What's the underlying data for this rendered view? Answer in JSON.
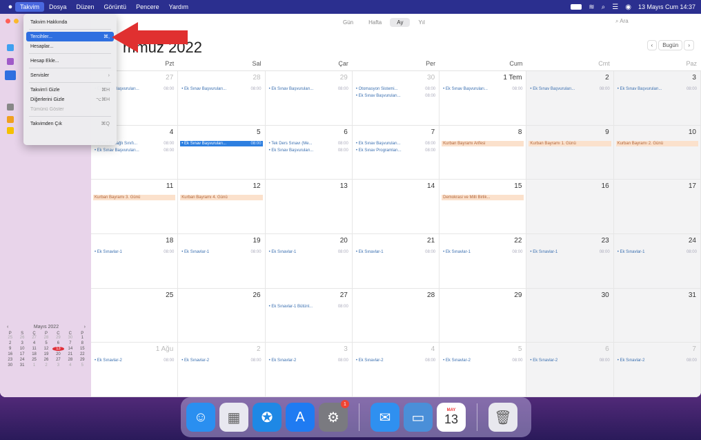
{
  "menubar": {
    "apple": "",
    "items": [
      "Takvim",
      "Dosya",
      "Düzen",
      "Görüntü",
      "Pencere",
      "Yardım"
    ],
    "active_index": 0,
    "datetime": "13 Mayıs Cum 14:37"
  },
  "app_menu": {
    "items": [
      {
        "label": "Takvim Hakkında",
        "shortcut": "",
        "type": "item"
      },
      {
        "type": "sep"
      },
      {
        "label": "Tercihler...",
        "shortcut": "⌘,",
        "type": "item",
        "highlight": true
      },
      {
        "label": "Hesaplar...",
        "shortcut": "",
        "type": "item"
      },
      {
        "type": "sep"
      },
      {
        "label": "Hesap Ekle...",
        "shortcut": "",
        "type": "item"
      },
      {
        "type": "sep"
      },
      {
        "label": "Servisler",
        "shortcut": "›",
        "type": "item"
      },
      {
        "type": "sep"
      },
      {
        "label": "Takvim'i Gizle",
        "shortcut": "⌘H",
        "type": "item"
      },
      {
        "label": "Diğerlerini Gizle",
        "shortcut": "⌥⌘H",
        "type": "item"
      },
      {
        "label": "Tümünü Göster",
        "shortcut": "",
        "type": "item",
        "disabled": true
      },
      {
        "type": "sep"
      },
      {
        "label": "Takvimden Çık",
        "shortcut": "⌘Q",
        "type": "item"
      }
    ]
  },
  "toolbar": {
    "views": [
      "Gün",
      "Hafta",
      "Ay",
      "Yıl"
    ],
    "selected_view": "Ay",
    "search_placeholder": "Ara"
  },
  "header": {
    "month_title": "mmuz 2022",
    "nav_prev": "‹",
    "today": "Bugün",
    "nav_next": "›"
  },
  "weekdays": [
    "Pzt",
    "Sal",
    "Çar",
    "Per",
    "Cum",
    "Cmt",
    "Paz"
  ],
  "weeks": [
    [
      {
        "day": "27",
        "dim": true,
        "events": [
          {
            "title": "Ek Sınav Başvuruları...",
            "time": "08:00"
          }
        ]
      },
      {
        "day": "28",
        "dim": true,
        "events": [
          {
            "title": "Ek Sınav Başvuruları...",
            "time": "08:00"
          }
        ]
      },
      {
        "day": "29",
        "dim": true,
        "events": [
          {
            "title": "Ek Sınav Başvuruları...",
            "time": "08:00"
          }
        ]
      },
      {
        "day": "30",
        "dim": true,
        "events": [
          {
            "title": "Otomasyon Sistemi...",
            "time": "08:00"
          },
          {
            "title": "Ek Sınav Başvuruları...",
            "time": "08:00"
          }
        ]
      },
      {
        "day": "1 Tem",
        "events": [
          {
            "title": "Ek Sınav Başvuruları...",
            "time": "08:00"
          }
        ]
      },
      {
        "day": "2",
        "events": [
          {
            "title": "Ek Sınav Başvuruları...",
            "time": "08:00"
          }
        ]
      },
      {
        "day": "3",
        "events": [
          {
            "title": "Ek Sınav Başvuruları...",
            "time": "08:00"
          }
        ]
      }
    ],
    [
      {
        "day": "4",
        "events": [
          {
            "title": "YÖKSİS Bağlı Sınıfı...",
            "time": "08:00"
          },
          {
            "title": "Ek Sınav Başvuruları...",
            "time": "08:00"
          }
        ]
      },
      {
        "day": "5",
        "events": [
          {
            "title": "Ek Sınav Başvuruları...",
            "time": "08:00",
            "selected": true
          }
        ]
      },
      {
        "day": "6",
        "events": [
          {
            "title": "Tek Ders Sınavı (Me...",
            "time": "08:00"
          },
          {
            "title": "Ek Sınav Başvuruları...",
            "time": "08:00"
          }
        ]
      },
      {
        "day": "7",
        "events": [
          {
            "title": "Ek Sınav Başvuruları...",
            "time": "08:00"
          },
          {
            "title": "Ek Sınav Programları...",
            "time": "08:00"
          }
        ]
      },
      {
        "day": "8",
        "events": [
          {
            "title": "Kurban Bayramı Arifesi",
            "allday": true
          }
        ]
      },
      {
        "day": "9",
        "events": [
          {
            "title": "Kurban Bayramı 1. Günü",
            "allday": true
          }
        ]
      },
      {
        "day": "10",
        "events": [
          {
            "title": "Kurban Bayramı 2. Günü",
            "allday": true
          }
        ]
      }
    ],
    [
      {
        "day": "11",
        "events": [
          {
            "title": "Kurban Bayramı 3. Günü",
            "allday": true
          }
        ]
      },
      {
        "day": "12",
        "events": [
          {
            "title": "Kurban Bayramı 4. Günü",
            "allday": true
          }
        ]
      },
      {
        "day": "13",
        "events": []
      },
      {
        "day": "14",
        "events": []
      },
      {
        "day": "15",
        "events": [
          {
            "title": "Demokrasi ve Milli Birlik...",
            "allday": true
          }
        ]
      },
      {
        "day": "16",
        "events": []
      },
      {
        "day": "17",
        "events": []
      }
    ],
    [
      {
        "day": "18",
        "events": [
          {
            "title": "Ek Sınavlar-1",
            "time": "08:00"
          }
        ]
      },
      {
        "day": "19",
        "events": [
          {
            "title": "Ek Sınavlar-1",
            "time": "08:00"
          }
        ]
      },
      {
        "day": "20",
        "events": [
          {
            "title": "Ek Sınavlar-1",
            "time": "08:00"
          }
        ]
      },
      {
        "day": "21",
        "events": [
          {
            "title": "Ek Sınavlar-1",
            "time": "08:00"
          }
        ]
      },
      {
        "day": "22",
        "events": [
          {
            "title": "Ek Sınavlar-1",
            "time": "08:00"
          }
        ]
      },
      {
        "day": "23",
        "events": [
          {
            "title": "Ek Sınavlar-1",
            "time": "08:00"
          }
        ]
      },
      {
        "day": "24",
        "events": [
          {
            "title": "Ek Sınavlar-1",
            "time": "08:00"
          }
        ]
      }
    ],
    [
      {
        "day": "25",
        "events": []
      },
      {
        "day": "26",
        "events": []
      },
      {
        "day": "27",
        "events": [
          {
            "title": "Ek Sınavlar-1 Bütünl...",
            "time": "08:00"
          }
        ]
      },
      {
        "day": "28",
        "events": []
      },
      {
        "day": "29",
        "events": []
      },
      {
        "day": "30",
        "events": []
      },
      {
        "day": "31",
        "events": []
      }
    ],
    [
      {
        "day": "1 Ağu",
        "dim": true,
        "events": [
          {
            "title": "Ek Sınavlar-2",
            "time": "08:00"
          }
        ]
      },
      {
        "day": "2",
        "dim": true,
        "events": [
          {
            "title": "Ek Sınavlar-2",
            "time": "08:00"
          }
        ]
      },
      {
        "day": "3",
        "dim": true,
        "events": [
          {
            "title": "Ek Sınavlar-2",
            "time": "08:00"
          }
        ]
      },
      {
        "day": "4",
        "dim": true,
        "events": [
          {
            "title": "Ek Sınavlar-2",
            "time": "08:00"
          }
        ]
      },
      {
        "day": "5",
        "dim": true,
        "events": [
          {
            "title": "Ek Sınavlar-2",
            "time": "08:00"
          }
        ]
      },
      {
        "day": "6",
        "dim": true,
        "events": [
          {
            "title": "Ek Sınavlar-2",
            "time": "08:00"
          }
        ]
      },
      {
        "day": "7",
        "dim": true,
        "events": [
          {
            "title": "Ek Sınavlar-2",
            "time": "08:00"
          }
        ]
      }
    ]
  ],
  "mini_calendar": {
    "title": "Mayıs 2022",
    "prev": "‹",
    "next": "›",
    "weekdays": [
      "P",
      "S",
      "Ç",
      "P",
      "C",
      "C",
      "P"
    ],
    "days": [
      "25",
      "26",
      "27",
      "28",
      "29",
      "30",
      "1",
      "2",
      "3",
      "4",
      "5",
      "6",
      "7",
      "8",
      "9",
      "10",
      "11",
      "12",
      "13",
      "14",
      "15",
      "16",
      "17",
      "18",
      "19",
      "20",
      "21",
      "22",
      "23",
      "24",
      "25",
      "26",
      "27",
      "28",
      "29",
      "30",
      "31",
      "1",
      "2",
      "3",
      "4",
      "5"
    ],
    "today": "13"
  },
  "dock": {
    "items": [
      {
        "name": "finder-icon",
        "glyph": "☺",
        "color": "#2a8ff0"
      },
      {
        "name": "launchpad-icon",
        "glyph": "▦",
        "color": "#e8e8f0"
      },
      {
        "name": "safari-icon",
        "glyph": "✪",
        "color": "#1e88e5"
      },
      {
        "name": "app-store-icon",
        "glyph": "A",
        "color": "#1f7bf2"
      },
      {
        "name": "system-preferences-icon",
        "glyph": "⚙",
        "color": "#7a7a80",
        "badge": "1"
      },
      {
        "name": "mail-icon",
        "glyph": "✉",
        "color": "#2f90f0"
      },
      {
        "name": "preview-icon",
        "glyph": "▭",
        "color": "#4a8fd8"
      },
      {
        "name": "calendar-icon",
        "month": "MAY",
        "day": "13"
      },
      {
        "name": "trash-icon",
        "glyph": "🗑",
        "color": "#e8e8ee"
      }
    ]
  },
  "colors": {
    "menubar_bg": "#2b2f8f",
    "highlight": "#2f6fe0",
    "allday_bg": "#fbe1cc",
    "event_text": "#3a6fb0",
    "arrow": "#e03030"
  }
}
